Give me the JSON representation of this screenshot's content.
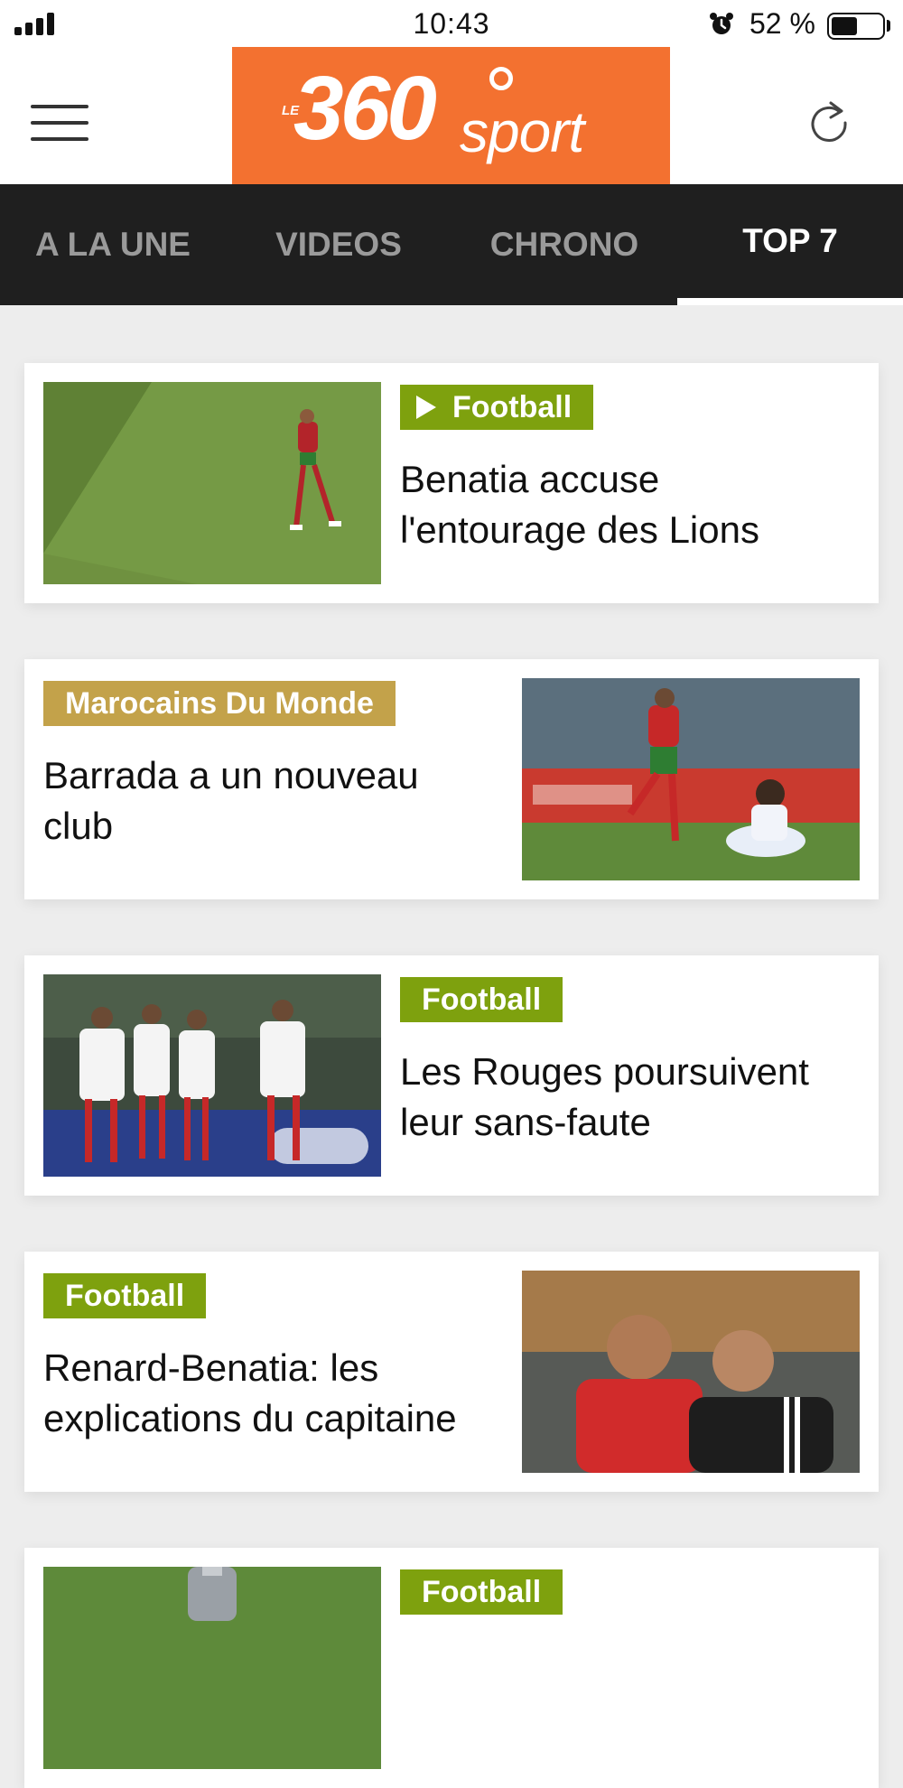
{
  "status_bar": {
    "time": "10:43",
    "battery": "52 %",
    "battery_level": 0.52,
    "icons": [
      "signal-icon",
      "alarm-icon",
      "battery-icon"
    ]
  },
  "header": {
    "logo": {
      "prefix": "LE",
      "number": "360",
      "word": "sport"
    },
    "brand_color": "#f37130",
    "menu_icon": "hamburger-menu-icon",
    "refresh_icon": "refresh-icon"
  },
  "tabs": [
    {
      "label": "A LA UNE",
      "active": false
    },
    {
      "label": "VIDEOS",
      "active": false
    },
    {
      "label": "CHRONO",
      "active": false
    },
    {
      "label": "TOP 7",
      "active": true
    }
  ],
  "articles": [
    {
      "category": "Football",
      "category_color": "#7ea10e",
      "video": true,
      "title": "Benatia accuse l'entourage des Lions"
    },
    {
      "category": "Marocains Du Monde",
      "category_color": "#c3a24a",
      "video": false,
      "title": "Barrada a un nouveau club"
    },
    {
      "category": "Football",
      "category_color": "#7ea10e",
      "video": false,
      "title": "Les Rouges poursuivent leur sans-faute"
    },
    {
      "category": "Football",
      "category_color": "#7ea10e",
      "video": false,
      "title": "Renard-Benatia: les explications du capitaine"
    },
    {
      "category": "Football",
      "category_color": "#7ea10e",
      "video": false,
      "title": ""
    }
  ]
}
